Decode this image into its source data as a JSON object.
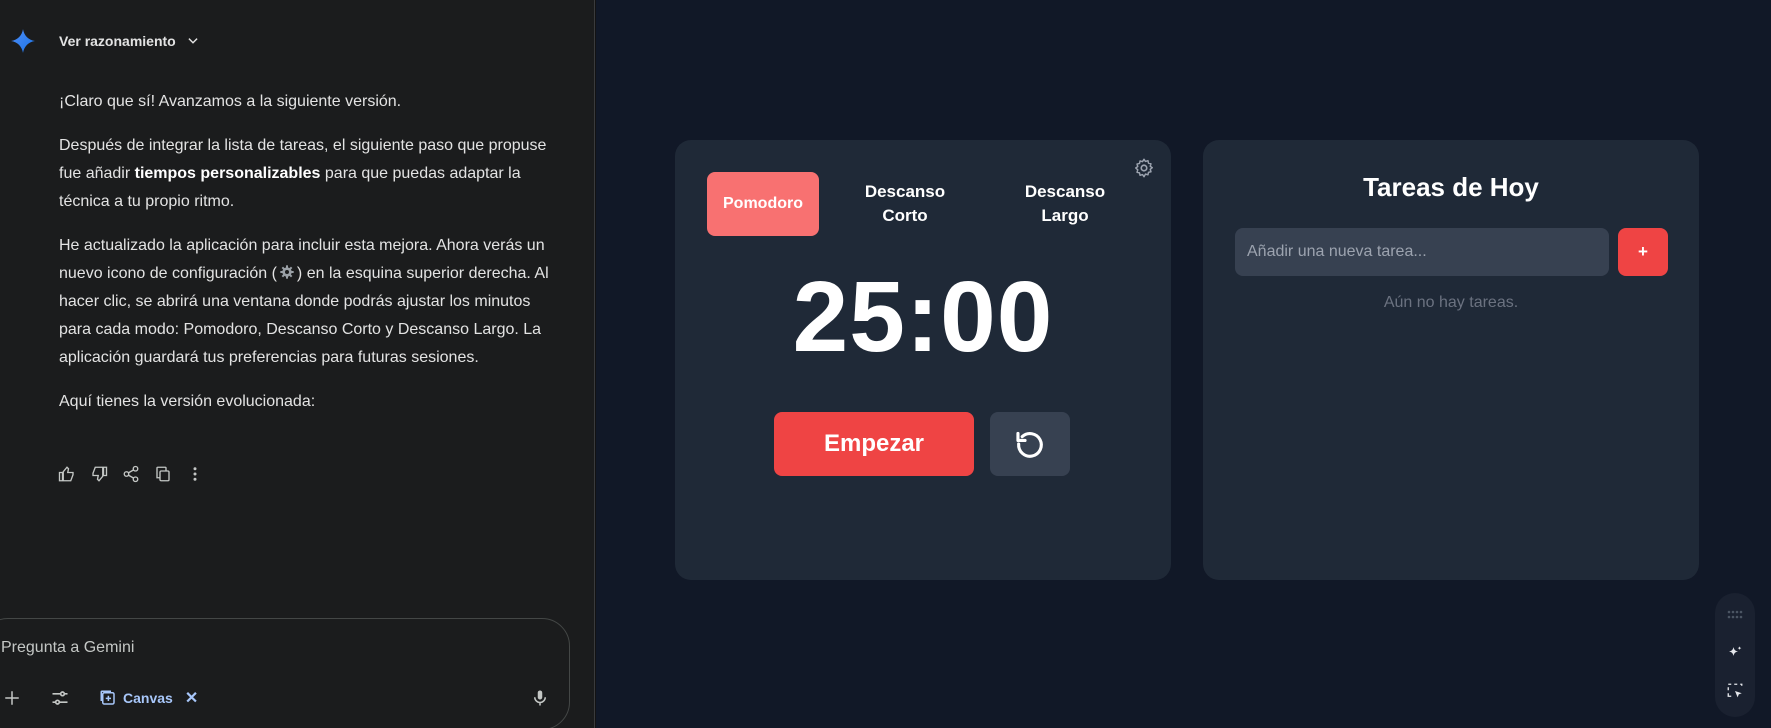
{
  "chat": {
    "reasoning_label": "Ver razonamiento",
    "paragraphs": {
      "p1": "¡Claro que sí! Avanzamos a la siguiente versión.",
      "p2a": "Después de integrar la lista de tareas, el siguiente paso que propuse fue añadir ",
      "p2b": "tiempos personalizables",
      "p2c": " para que puedas adaptar la técnica a tu propio ritmo.",
      "p3a": "He actualizado la aplicación para incluir esta mejora. Ahora verás un nuevo icono de configuración (",
      "p3b": ") en la esquina superior derecha. Al hacer clic, se abrirá una ventana donde podrás ajustar los minutos para cada modo: Pomodoro, Descanso Corto y Descanso Largo. La aplicación guardará tus preferencias para futuras sesiones.",
      "p4": "Aquí tienes la versión evolucionada:"
    },
    "actions": [
      "thumb-up-icon",
      "thumb-down-icon",
      "share-icon",
      "copy-icon",
      "more-vert-icon"
    ],
    "composer": {
      "placeholder": "Pregunta a Gemini",
      "canvas_label": "Canvas",
      "canvas_close": "✕"
    }
  },
  "app": {
    "modes": {
      "pomodoro": "Pomodoro",
      "short_break": "Descanso Corto",
      "long_break": "Descanso Largo"
    },
    "time": "25:00",
    "start_label": "Empezar",
    "tasks": {
      "title": "Tareas de Hoy",
      "input_placeholder": "Añadir una nueva tarea...",
      "add_label": "+",
      "empty_text": "Aún no hay tareas."
    },
    "colors": {
      "accent": "#ef4444",
      "active_mode": "#f87171",
      "card": "#1f2937",
      "background": "#111827"
    }
  }
}
